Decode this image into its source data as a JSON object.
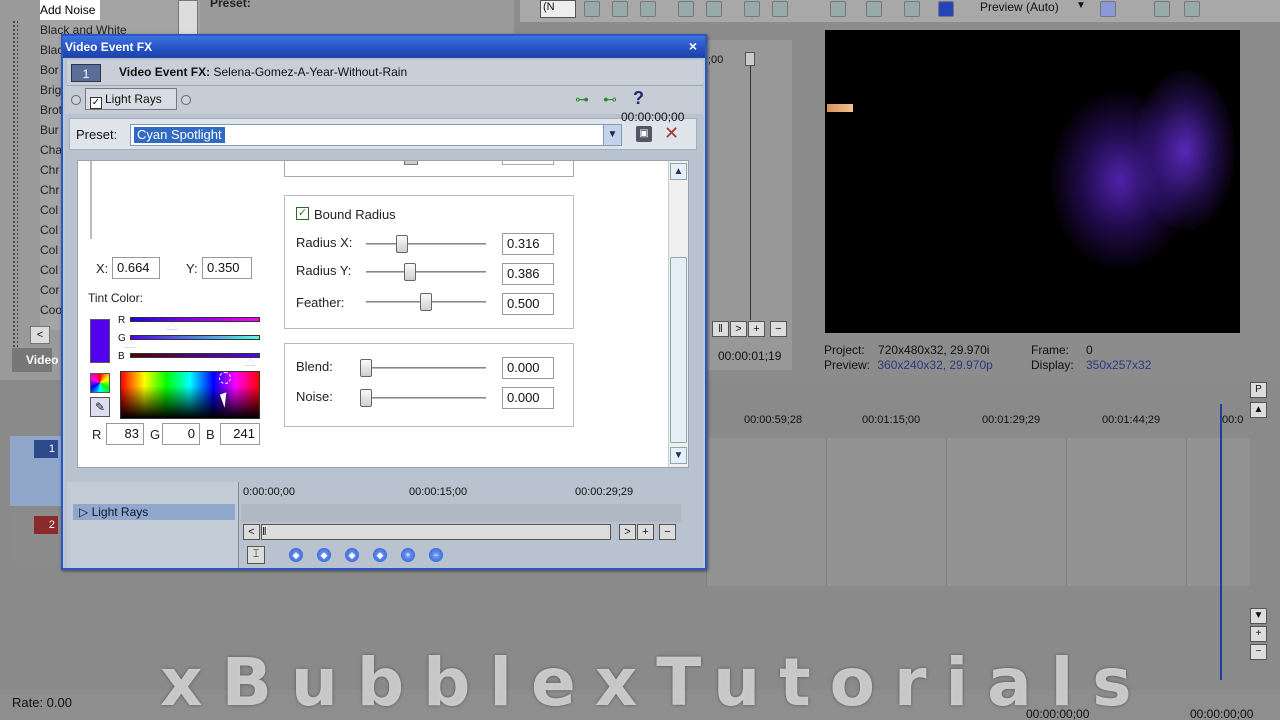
{
  "effects_list": {
    "items": [
      "Add Noise",
      "Black and White",
      "Black",
      "Bor",
      "Brig",
      "Brot",
      "Bur",
      "Cha",
      "Chr",
      "Chr",
      "Col",
      "Col",
      "Col",
      "Col",
      "Cor",
      "Coo"
    ],
    "tab_label": "Video"
  },
  "bg_preset_label": "Preset:",
  "toolbar": {
    "combo_value": "(N",
    "preview_quality": "Preview (Auto)"
  },
  "video_preview": {
    "project_label": "Project:",
    "project_value": "720x480x32, 29.970i",
    "frame_label": "Frame:",
    "frame_value": "0",
    "preview_label": "Preview:",
    "preview_value": "360x240x32, 29.970p",
    "display_label": "Display:",
    "display_value": "350x257x32"
  },
  "mid_strip": {
    "zero_label": ";00",
    "time": "00:00:01;19"
  },
  "timeline": {
    "ticks": [
      "00:00:59;28",
      "00:01:15;00",
      "00:01:29;29",
      "00:01:44;29",
      "00:0"
    ],
    "track1_num": "1",
    "track2_num": "2",
    "rate": "Rate: 0.00",
    "time_left": "00:00:00;00",
    "time_right": "00:00:00;00"
  },
  "watermark": "xBubblexTutorials",
  "fx_dialog": {
    "title": "Video Event FX",
    "close": "×",
    "chain_num": "1",
    "chain_title_bold": "Video Event FX:",
    "chain_title_file": "Selena-Gomez-A-Year-Without-Rain",
    "plugin_name": "Light Rays",
    "preset_label": "Preset:",
    "preset_value": "Cyan Spotlight",
    "help_icon": "?",
    "x_label": "X:",
    "x_value": "0.664",
    "y_label": "Y:",
    "y_value": "0.350",
    "tint_label": "Tint Color:",
    "tint_letters": [
      "R",
      "G",
      "B"
    ],
    "tint_color": "#5300f1",
    "rgb": {
      "r_label": "R",
      "r": "83",
      "g_label": "G",
      "g": "0",
      "b_label": "B",
      "b": "241"
    },
    "bound_radius_label": "Bound Radius",
    "bound_radius_checked": true,
    "radius_x_label": "Radius X:",
    "radius_x": "0.316",
    "radius_y_label": "Radius Y:",
    "radius_y": "0.386",
    "feather_label": "Feather:",
    "feather": "0.500",
    "blend_label": "Blend:",
    "blend": "0.000",
    "noise_label": "Noise:",
    "noise": "0.000",
    "timeline_row": "Light Rays",
    "ruler": [
      "0:00:00;00",
      "00:00:15;00",
      "00:00:29;29"
    ],
    "timeline_time": "00:00:00;00"
  }
}
